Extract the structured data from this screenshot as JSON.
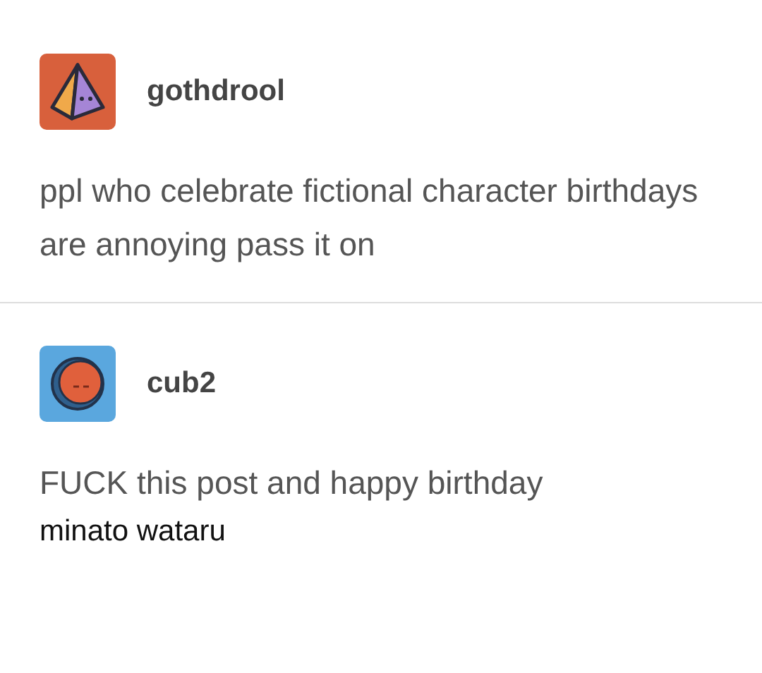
{
  "posts": [
    {
      "username": "gothdrool",
      "avatar": {
        "kind": "pyramid"
      },
      "text": "ppl who celebrate fictional character birthdays are annoying pass it on"
    },
    {
      "username": "cub2",
      "avatar": {
        "kind": "moon"
      },
      "text": "FUCK this post and happy birthday",
      "addendum": "minato wataru"
    }
  ]
}
